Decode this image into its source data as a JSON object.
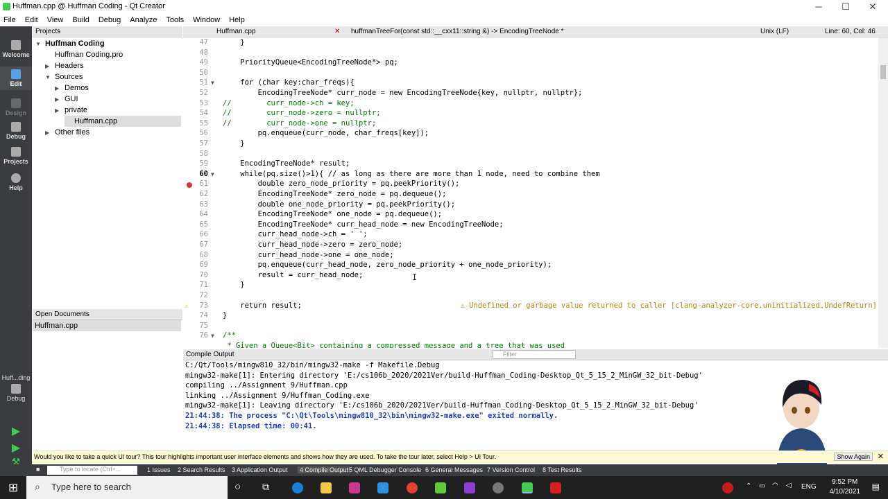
{
  "window": {
    "title": "Huffman.cpp @ Huffman Coding - Qt Creator",
    "minimize": "─",
    "maximize": "☐",
    "close": "✕"
  },
  "menu": [
    "File",
    "Edit",
    "View",
    "Build",
    "Debug",
    "Analyze",
    "Tools",
    "Window",
    "Help"
  ],
  "modes": [
    {
      "label": "Welcome",
      "icon": "grid-icon"
    },
    {
      "label": "Edit",
      "icon": "edit-icon"
    },
    {
      "label": "Design",
      "icon": "design-icon"
    },
    {
      "label": "Debug",
      "icon": "bug-icon"
    },
    {
      "label": "Projects",
      "icon": "wrench-icon"
    },
    {
      "label": "Help",
      "icon": "help-icon"
    }
  ],
  "kit_label": "Huff...ding",
  "kit_mode": "Debug",
  "projects_header": "Projects",
  "tree": [
    {
      "label": "Huffman Coding",
      "level": 0,
      "arrow": "▼",
      "bold": true
    },
    {
      "label": "Huffman Coding.pro",
      "level": 1,
      "arrow": ""
    },
    {
      "label": "Headers",
      "level": 1,
      "arrow": "▶"
    },
    {
      "label": "Sources",
      "level": 1,
      "arrow": "▼"
    },
    {
      "label": "Demos",
      "level": 2,
      "arrow": "▶"
    },
    {
      "label": "GUI",
      "level": 2,
      "arrow": "▶"
    },
    {
      "label": "private",
      "level": 2,
      "arrow": "▶"
    },
    {
      "label": "Huffman.cpp",
      "level": 2,
      "arrow": "",
      "selected": true
    },
    {
      "label": "Other files",
      "level": 1,
      "arrow": "▶"
    }
  ],
  "open_docs_header": "Open Documents",
  "open_docs": [
    "Huffman.cpp"
  ],
  "editor_toolbar": {
    "file": "Huffman.cpp",
    "symbol": "huffmanTreeFor(const std::__cxx11::string &) -> EncodingTreeNode *",
    "line_ending": "Unix (LF)",
    "position": "Line: 60, Col: 46"
  },
  "code_lines": [
    {
      "n": "47",
      "t": "    }"
    },
    {
      "n": "48",
      "t": ""
    },
    {
      "n": "49",
      "t": "    PriorityQueue<EncodingTreeNode*> pq;"
    },
    {
      "n": "50",
      "t": ""
    },
    {
      "n": "51",
      "t": "    for (char key:char_freqs){",
      "fold": "▼"
    },
    {
      "n": "52",
      "t": "        EncodingTreeNode* curr_node = new EncodingTreeNode{key, nullptr, nullptr};"
    },
    {
      "n": "53",
      "t": "//        curr_node->ch = key;"
    },
    {
      "n": "54",
      "t": "//        curr_node->zero = nullptr;"
    },
    {
      "n": "55",
      "t": "//        curr_node->one = nullptr;"
    },
    {
      "n": "56",
      "t": "        pq.enqueue(curr_node, char_freqs[key]);"
    },
    {
      "n": "57",
      "t": "    }"
    },
    {
      "n": "58",
      "t": ""
    },
    {
      "n": "59",
      "t": "    EncodingTreeNode* result;"
    },
    {
      "n": "60",
      "t": "    while(pq.size()>1){ // as long as there are more than 1 node, need to combine them",
      "fold": "▼"
    },
    {
      "n": "61",
      "t": "        double zero_node_priority = pq.peekPriority();"
    },
    {
      "n": "62",
      "t": "        EncodingTreeNode* zero_node = pq.dequeue();"
    },
    {
      "n": "63",
      "t": "        double one_node_priority = pq.peekPriority();"
    },
    {
      "n": "64",
      "t": "        EncodingTreeNode* one_node = pq.dequeue();"
    },
    {
      "n": "65",
      "t": "        EncodingTreeNode* curr_head_node = new EncodingTreeNode;"
    },
    {
      "n": "66",
      "t": "        curr_head_node->ch = ' ';"
    },
    {
      "n": "67",
      "t": "        curr_head_node->zero = zero_node;"
    },
    {
      "n": "68",
      "t": "        curr_head_node->one = one_node;"
    },
    {
      "n": "69",
      "t": "        pq.enqueue(curr_head_node, zero_node_priority + one_node_priority);"
    },
    {
      "n": "70",
      "t": "        result = curr_head_node;"
    },
    {
      "n": "71",
      "t": "    }"
    },
    {
      "n": "72",
      "t": ""
    },
    {
      "n": "73",
      "t": "    return result;"
    },
    {
      "n": "74",
      "t": "}"
    },
    {
      "n": "75",
      "t": ""
    },
    {
      "n": "76",
      "t": "/**",
      "fold": "▼"
    },
    {
      "n": "",
      "t": " * Given a Queue<Bit> containing a compressed message and a tree that was used"
    }
  ],
  "warning": "⚠ Undefined or garbage value returned to caller [clang-analyzer-core.uninitialized.UndefReturn]",
  "compile_header": "Compile Output",
  "filter_placeholder": "Filter",
  "output_lines": [
    {
      "t": "C:/Qt/Tools/mingw810_32/bin/mingw32-make -f Makefile.Debug",
      "blue": false
    },
    {
      "t": "mingw32-make[1]: Entering directory 'E:/cs106b_2020/2021Ver/build-Huffman_Coding-Desktop_Qt_5_15_2_MinGW_32_bit-Debug'",
      "blue": false
    },
    {
      "t": "compiling ../Assignment 9/Huffman.cpp",
      "blue": false
    },
    {
      "t": "linking ../Assignment 9/Huffman_Coding.exe",
      "blue": false
    },
    {
      "t": "mingw32-make[1]: Leaving directory 'E:/cs106b_2020/2021Ver/build-Huffman_Coding-Desktop_Qt_5_15_2_MinGW_32_bit-Debug'",
      "blue": false
    },
    {
      "t": "21:44:38: The process \"C:\\Qt\\Tools\\mingw810_32\\bin\\mingw32-make.exe\" exited normally.",
      "blue": true
    },
    {
      "t": "21:44:38: Elapsed time: 00:41.",
      "blue": true
    }
  ],
  "tour": {
    "text": "Would you like to take a quick UI tour? This tour highlights important user interface elements and shows how they are used. To take the tour later, select Help > UI Tour.",
    "button": "Show Again"
  },
  "locator_placeholder": "Type to locate (Ctrl+...",
  "output_tabs": [
    "1  Issues",
    "2  Search Results",
    "3  Application Output",
    "4  Compile Output",
    "5  QML Debugger Console",
    "6  General Messages",
    "7  Version Control",
    "8  Test Results"
  ],
  "taskbar": {
    "search_placeholder": "Type here to search",
    "time": "9:52 PM",
    "date": "4/10/2021",
    "lang": "ENG"
  },
  "colors": {
    "modebar": "#3a3c3f",
    "taskbar": "#202020",
    "warning": "#b8860b",
    "output_blue": "#1f3fbf"
  }
}
